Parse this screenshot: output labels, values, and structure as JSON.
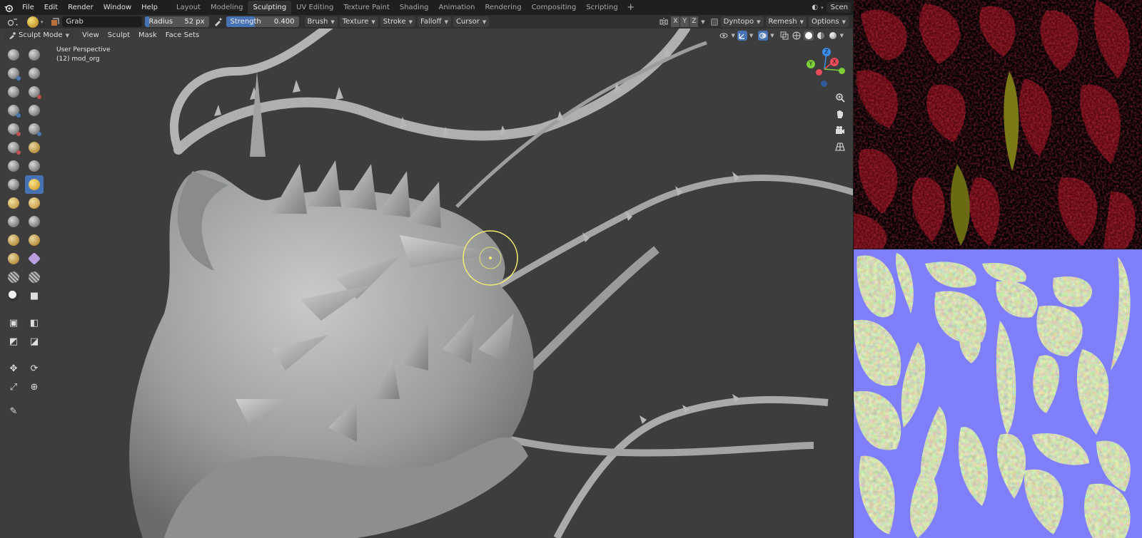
{
  "menu": {
    "items": [
      "File",
      "Edit",
      "Render",
      "Window",
      "Help"
    ]
  },
  "workspaces": {
    "tabs": [
      "Layout",
      "Modeling",
      "Sculpting",
      "UV Editing",
      "Texture Paint",
      "Shading",
      "Animation",
      "Rendering",
      "Compositing",
      "Scripting"
    ],
    "active": "Sculpting"
  },
  "scene": {
    "label": "Scen"
  },
  "tool_settings": {
    "brush_name": "Grab",
    "radius_label": "Radius",
    "radius_value": "52 px",
    "strength_label": "Strength",
    "strength_value": "0.400",
    "strength_fraction": 0.4,
    "menus": [
      "Brush",
      "Texture",
      "Stroke",
      "Falloff",
      "Cursor"
    ],
    "axes": [
      "X",
      "Y",
      "Z"
    ],
    "dyntopo": "Dyntopo",
    "remesh": "Remesh",
    "options": "Options"
  },
  "view_header": {
    "mode": "Sculpt Mode",
    "menus": [
      "View",
      "Sculpt",
      "Mask",
      "Face Sets"
    ]
  },
  "viewport": {
    "perspective": "User Perspective",
    "object": "(12) mod_org"
  },
  "gizmo": {
    "x_label": "X",
    "y_label": "Y",
    "z_label": "Z",
    "x_color": "#e84b5a",
    "y_color": "#7fcf3b",
    "z_color": "#3b8de8"
  },
  "colors": {
    "accent": "#4772b3",
    "viewport_bg": "#3d3d3d",
    "normal_map_bg": "#7f7ffc",
    "cursor_ring": "#f4f070"
  },
  "toolbar_icons": [
    "draw-brush-icon",
    "draw-sharp-brush-icon",
    "clay-brush-icon",
    "clay-strips-brush-icon",
    "clay-thumb-brush-icon",
    "layer-brush-icon",
    "inflate-brush-icon",
    "blob-brush-icon",
    "crease-brush-icon",
    "smooth-brush-icon",
    "flatten-brush-icon",
    "fill-brush-icon",
    "scrape-brush-icon",
    "multiplane-scrape-brush-icon",
    "pinch-brush-icon",
    "grab-brush-icon",
    "elastic-deform-brush-icon",
    "snake-hook-brush-icon",
    "thumb-brush-icon",
    "pose-brush-icon",
    "nudge-brush-icon",
    "rotate-brush-icon",
    "slide-relax-brush-icon",
    "boundary-brush-icon",
    "cloth-brush-icon",
    "simplify-brush-icon",
    "mask-brush-icon",
    "draw-face-sets-icon",
    "box-mask-icon",
    "lasso-mask-icon",
    "box-face-set-icon",
    "lasso-face-set-icon",
    "move-icon",
    "rotate-icon",
    "scale-icon",
    "transform-icon",
    "annotate-icon"
  ]
}
